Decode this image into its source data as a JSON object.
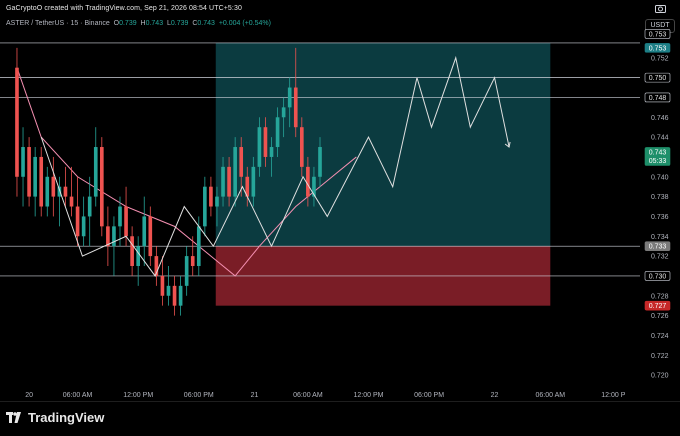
{
  "header": {
    "created_text": "GaCryptoO created with TradingView.com, Sep 21, 2026 08:54 UTC+5:30"
  },
  "legend": {
    "symbol": "ASTER / TetherUS · 15 · Binance",
    "open_label": "O",
    "open": "0.739",
    "high_label": "H",
    "high": "0.743",
    "low_label": "L",
    "low": "0.739",
    "close_label": "C",
    "close": "0.743",
    "change": "+0.004 (+0.54%)"
  },
  "unit_button": "USDT",
  "footer": {
    "brand": "TradingView"
  },
  "colors": {
    "up": "#26a69a",
    "down": "#ef5350",
    "ma": "#f48fb1",
    "ma2": "#a5d6a7",
    "profit_zone": "#0b3b40",
    "loss_zone": "#7a1d26",
    "projection": "#e0e0e0"
  },
  "chart_data": {
    "type": "candlestick",
    "y_ticks": [
      "0.753",
      "0.752",
      "0.750",
      "0.748",
      "0.746",
      "0.744",
      "0.742",
      "0.740",
      "0.738",
      "0.736",
      "0.734",
      "0.732",
      "0.730",
      "0.728",
      "0.726",
      "0.724",
      "0.722",
      "0.720"
    ],
    "x_ticks": [
      "20",
      "06:00 AM",
      "12:00 PM",
      "06:00 PM",
      "21",
      "06:00 AM",
      "12:00 PM",
      "06:00 PM",
      "22",
      "06:00 AM",
      "12:00 P"
    ],
    "price_tags": [
      {
        "value": "0.753",
        "style": "outline"
      },
      {
        "value": "0.753",
        "style": "teal"
      },
      {
        "value": "0.750",
        "style": "outline"
      },
      {
        "value": "0.748",
        "style": "outline"
      },
      {
        "value": "0.743",
        "sub": "05:33",
        "style": "green"
      },
      {
        "value": "0.733",
        "style": "gray"
      },
      {
        "value": "0.730",
        "style": "outline"
      },
      {
        "value": "0.727",
        "style": "red"
      }
    ],
    "horizontal_levels": [
      0.7535,
      0.75,
      0.748,
      0.733,
      0.73
    ],
    "position": {
      "entry": 0.733,
      "target": 0.7535,
      "stop": 0.727
    },
    "candles": [
      [
        0.751,
        0.753,
        0.738,
        0.74
      ],
      [
        0.74,
        0.745,
        0.737,
        0.743
      ],
      [
        0.743,
        0.744,
        0.737,
        0.738
      ],
      [
        0.738,
        0.743,
        0.736,
        0.742
      ],
      [
        0.742,
        0.743,
        0.736,
        0.737
      ],
      [
        0.737,
        0.741,
        0.736,
        0.74
      ],
      [
        0.74,
        0.742,
        0.736,
        0.738
      ],
      [
        0.738,
        0.74,
        0.735,
        0.739
      ],
      [
        0.739,
        0.741,
        0.737,
        0.738
      ],
      [
        0.738,
        0.741,
        0.736,
        0.737
      ],
      [
        0.737,
        0.74,
        0.733,
        0.734
      ],
      [
        0.734,
        0.738,
        0.733,
        0.736
      ],
      [
        0.736,
        0.74,
        0.733,
        0.738
      ],
      [
        0.738,
        0.745,
        0.737,
        0.743
      ],
      [
        0.743,
        0.744,
        0.734,
        0.735
      ],
      [
        0.735,
        0.737,
        0.731,
        0.733
      ],
      [
        0.733,
        0.736,
        0.73,
        0.735
      ],
      [
        0.735,
        0.738,
        0.733,
        0.737
      ],
      [
        0.737,
        0.739,
        0.733,
        0.734
      ],
      [
        0.734,
        0.735,
        0.73,
        0.731
      ],
      [
        0.731,
        0.734,
        0.729,
        0.733
      ],
      [
        0.733,
        0.738,
        0.731,
        0.736
      ],
      [
        0.736,
        0.737,
        0.731,
        0.732
      ],
      [
        0.732,
        0.733,
        0.729,
        0.73
      ],
      [
        0.73,
        0.732,
        0.727,
        0.728
      ],
      [
        0.728,
        0.731,
        0.727,
        0.729
      ],
      [
        0.729,
        0.73,
        0.726,
        0.727
      ],
      [
        0.727,
        0.73,
        0.726,
        0.729
      ],
      [
        0.729,
        0.733,
        0.728,
        0.732
      ],
      [
        0.732,
        0.734,
        0.73,
        0.731
      ],
      [
        0.731,
        0.736,
        0.73,
        0.735
      ],
      [
        0.735,
        0.74,
        0.734,
        0.739
      ],
      [
        0.739,
        0.74,
        0.736,
        0.737
      ],
      [
        0.737,
        0.739,
        0.735,
        0.738
      ],
      [
        0.738,
        0.742,
        0.737,
        0.741
      ],
      [
        0.741,
        0.742,
        0.737,
        0.738
      ],
      [
        0.738,
        0.744,
        0.737,
        0.743
      ],
      [
        0.743,
        0.744,
        0.738,
        0.74
      ],
      [
        0.74,
        0.741,
        0.737,
        0.738
      ],
      [
        0.738,
        0.742,
        0.737,
        0.741
      ],
      [
        0.741,
        0.746,
        0.74,
        0.745
      ],
      [
        0.745,
        0.746,
        0.741,
        0.742
      ],
      [
        0.742,
        0.744,
        0.74,
        0.743
      ],
      [
        0.743,
        0.747,
        0.742,
        0.746
      ],
      [
        0.746,
        0.748,
        0.744,
        0.747
      ],
      [
        0.747,
        0.75,
        0.745,
        0.749
      ],
      [
        0.749,
        0.753,
        0.744,
        0.745
      ],
      [
        0.745,
        0.746,
        0.74,
        0.741
      ],
      [
        0.741,
        0.742,
        0.737,
        0.738
      ],
      [
        0.738,
        0.741,
        0.737,
        0.74
      ],
      [
        0.74,
        0.744,
        0.739,
        0.743
      ]
    ],
    "candle_time_start": 0.5,
    "candle_time_step": 0.25,
    "ma_line": [
      [
        0.5,
        0.751
      ],
      [
        1.5,
        0.744
      ],
      [
        3,
        0.74
      ],
      [
        5,
        0.737
      ],
      [
        7,
        0.735
      ],
      [
        8.5,
        0.732
      ],
      [
        9.5,
        0.73
      ],
      [
        10.5,
        0.733
      ],
      [
        12,
        0.737
      ],
      [
        13.5,
        0.74
      ],
      [
        14.5,
        0.742
      ]
    ],
    "projection_path": [
      [
        1.5,
        0.744
      ],
      [
        3.2,
        0.732
      ],
      [
        5.0,
        0.734
      ],
      [
        6.2,
        0.73
      ],
      [
        7.4,
        0.737
      ],
      [
        8.6,
        0.733
      ],
      [
        9.8,
        0.739
      ],
      [
        11.0,
        0.733
      ],
      [
        12.3,
        0.74
      ],
      [
        13.3,
        0.736
      ],
      [
        15.0,
        0.744
      ],
      [
        16.0,
        0.739
      ],
      [
        17.0,
        0.75
      ],
      [
        17.6,
        0.745
      ],
      [
        18.6,
        0.752
      ],
      [
        19.2,
        0.745
      ],
      [
        20.2,
        0.75
      ],
      [
        20.8,
        0.743
      ]
    ],
    "x_range": [
      -0.2,
      26.2
    ],
    "y_range": [
      0.719,
      0.7545
    ]
  }
}
